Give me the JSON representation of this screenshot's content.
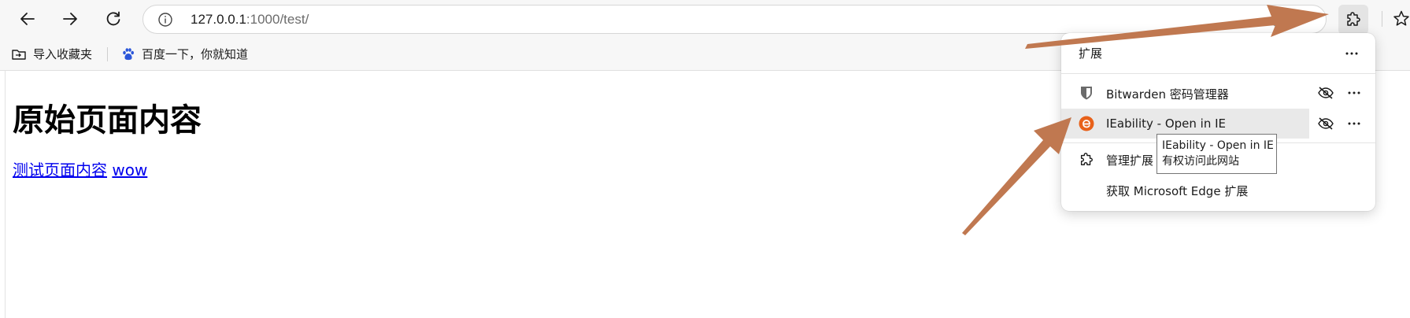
{
  "toolbar": {
    "url_host": "127.0.0.1",
    "url_rest": ":1000/test/",
    "icons": [
      "back-arrow-icon",
      "forward-arrow-icon",
      "refresh-icon",
      "info-icon",
      "extensions-puzzle-icon",
      "favorites-star-icon"
    ]
  },
  "bookmarks": {
    "import_label": "导入收藏夹",
    "baidu_label": "百度一下，你就知道"
  },
  "page": {
    "heading": "原始页面内容",
    "link1": "测试页面内容",
    "link2": "wow"
  },
  "extensions_popup": {
    "title": "扩展",
    "items": [
      {
        "name": "Bitwarden 密码管理器",
        "icon": "bitwarden-shield-icon"
      },
      {
        "name": "IEability - Open in IE",
        "icon": "ieability-e-icon"
      }
    ],
    "manage_label": "管理扩展",
    "get_label": "获取 Microsoft Edge 扩展"
  },
  "tooltip": {
    "line1": "IEability - Open in IE",
    "line2": "有权访问此网站"
  },
  "colors": {
    "arrow": "#c07850",
    "link": "#0000ee",
    "ie_orange": "#e8611a"
  }
}
